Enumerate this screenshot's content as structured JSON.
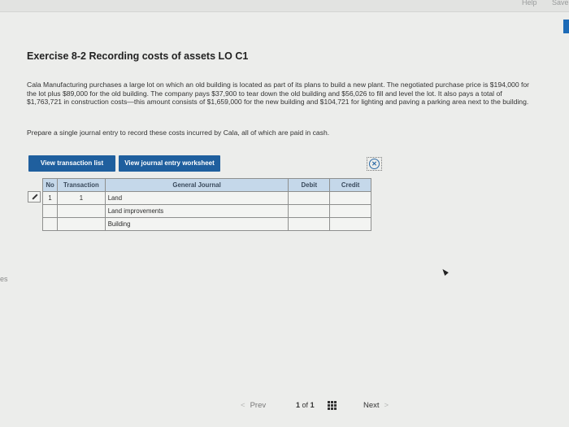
{
  "header": {
    "help_label": "Help",
    "save_label": "Save"
  },
  "exercise": {
    "title": "Exercise 8-2 Recording costs of assets LO C1",
    "paragraph": "Cala Manufacturing purchases a large lot on which an old building is located as part of its plans to build a new plant. The negotiated purchase price is $194,000 for the lot plus $89,000 for the old building. The company pays $37,900 to tear down the old building and $56,026 to fill and level the lot. It also pays a total of $1,763,721 in construction costs—this amount consists of $1,659,000 for the new building and $104,721 for lighting and paving a parking area next to the building.",
    "instruction": "Prepare a single journal entry to record these costs incurred by Cala, all of which are paid in cash."
  },
  "buttons": {
    "view_transaction_list": "View transaction list",
    "view_journal_worksheet": "View journal entry worksheet"
  },
  "journal": {
    "headers": {
      "no": "No",
      "transaction": "Transaction",
      "general_journal": "General Journal",
      "debit": "Debit",
      "credit": "Credit"
    },
    "rows": [
      {
        "no": "1",
        "transaction": "1",
        "account": "Land",
        "debit": "",
        "credit": ""
      },
      {
        "no": "",
        "transaction": "",
        "account": "Land improvements",
        "debit": "",
        "credit": ""
      },
      {
        "no": "",
        "transaction": "",
        "account": "Building",
        "debit": "",
        "credit": ""
      }
    ]
  },
  "pagination": {
    "prev_label": "Prev",
    "current": "1",
    "of": "of",
    "total": "1",
    "next_label": "Next"
  },
  "icons": {
    "close": "close-circle-icon",
    "edit": "pencil-icon",
    "grid": "grid-icon"
  },
  "colors": {
    "button_bg": "#1f5f9e",
    "table_header_bg": "#c5d8ea",
    "accent_tab": "#1d6bb7"
  }
}
